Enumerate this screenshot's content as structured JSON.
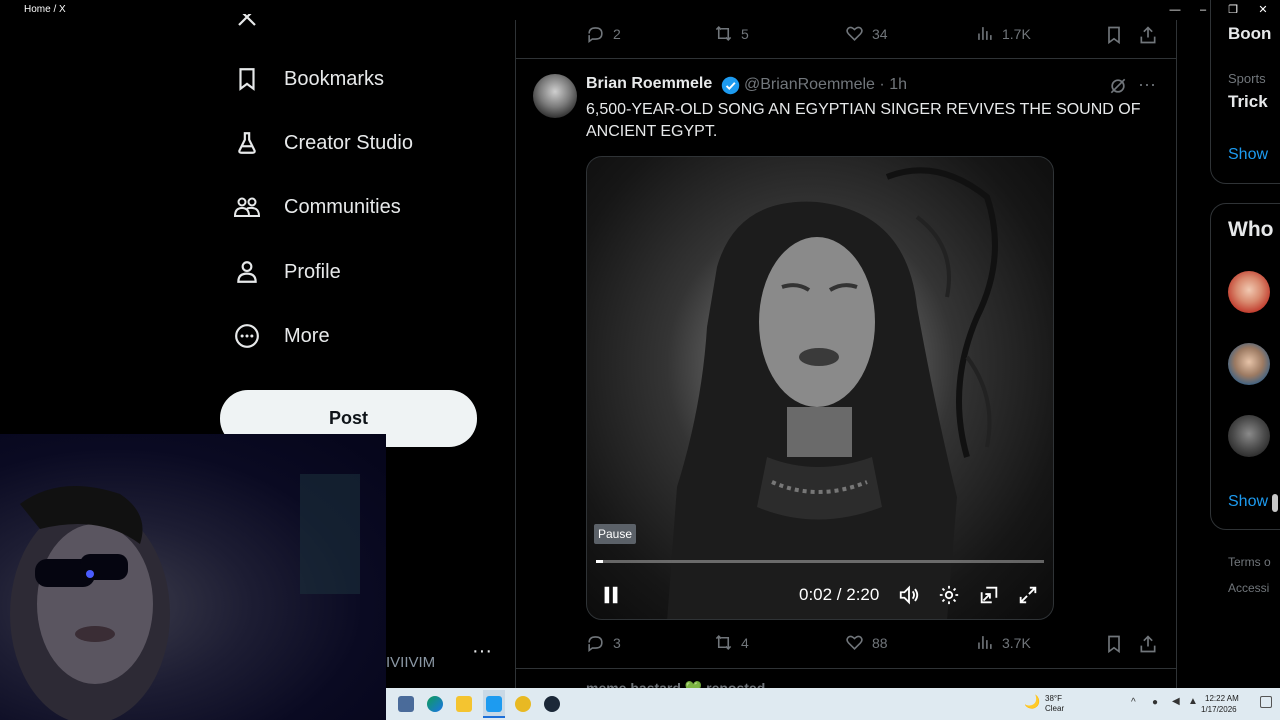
{
  "window": {
    "title": "Home / X"
  },
  "nav": {
    "items": [
      {
        "label": "Bookmarks",
        "icon": "bookmark-icon"
      },
      {
        "label": "Creator Studio",
        "icon": "flask-icon"
      },
      {
        "label": "Communities",
        "icon": "communities-icon"
      },
      {
        "label": "Profile",
        "icon": "person-icon"
      },
      {
        "label": "More",
        "icon": "more-circle-icon"
      }
    ],
    "post_label": "Post"
  },
  "account": {
    "handle_partial": "IVIIVIM"
  },
  "prev_tweet": {
    "replies": "2",
    "reposts": "5",
    "likes": "34",
    "views": "1.7K"
  },
  "tweet": {
    "author": "Brian Roemmele",
    "handle": "@BrianRoemmele",
    "time": "1h",
    "separator": "·",
    "text": "6,500-YEAR-OLD SONG AN EGYPTIAN SINGER REVIVES THE SOUND OF ANCIENT EGYPT.",
    "video": {
      "tooltip": "Pause",
      "time": "0:02 / 2:20",
      "progress": 0.015
    },
    "replies": "3",
    "reposts": "4",
    "likes": "88",
    "views": "3.7K"
  },
  "next_tweet": {
    "repost_line": "meme bastard 💚 reposted"
  },
  "sidebar": {
    "trend_title_partial": "Boon",
    "trend_category": "Sports",
    "trend_name_partial": "Trick",
    "show_more": "Show",
    "who_title": "Who",
    "show_more2": "Show",
    "footer_terms": "Terms o",
    "footer_access": "Accessi"
  },
  "taskbar": {
    "weather_temp": "38°F",
    "weather_cond": "Clear",
    "clock_time": "12:22 AM",
    "clock_date": "1/17/2026"
  },
  "colors": {
    "accent": "#1d9bf0",
    "post_bg": "#eff3f4",
    "muted": "#71767b",
    "divider": "#2f3336"
  }
}
